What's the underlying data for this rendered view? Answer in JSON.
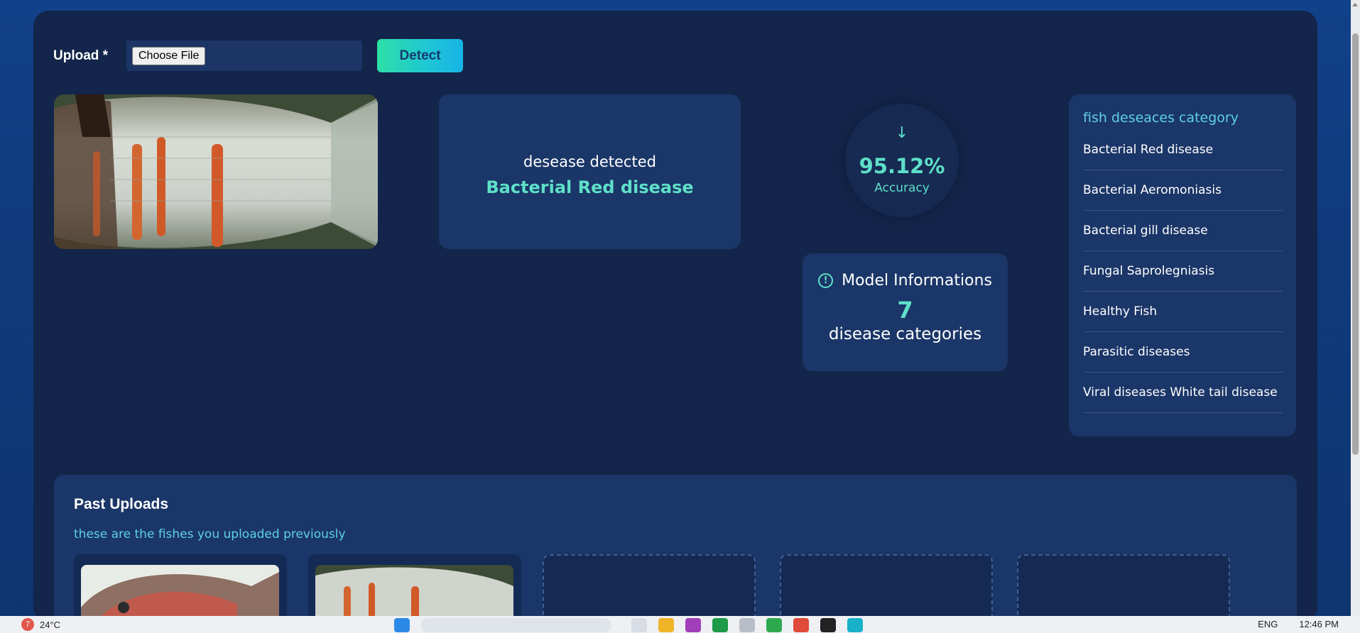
{
  "upload": {
    "label": "Upload *",
    "file_button": "Choose File",
    "detect_label": "Detect"
  },
  "result": {
    "label": "desease detected",
    "value": "Bacterial Red disease"
  },
  "accuracy": {
    "arrow": "↓",
    "value": "95.12%",
    "label": "Accuracy"
  },
  "model_info": {
    "title": "Model Informations",
    "count": "7",
    "subtitle": "disease categories"
  },
  "categories": {
    "title": "fish deseaces category",
    "items": [
      "Bacterial Red disease",
      "Bacterial Aeromoniasis",
      "Bacterial gill disease",
      "Fungal Saprolegniasis",
      "Healthy Fish",
      "Parasitic diseases",
      "Viral diseases White tail disease"
    ]
  },
  "past_uploads": {
    "title": "Past Uploads",
    "subtitle": "these are the fishes you uploaded previously"
  },
  "taskbar": {
    "weather_badge": "7",
    "temperature": "24°C",
    "language": "ENG",
    "time": "12:46 PM"
  },
  "colors": {
    "accent": "#5ee0c8",
    "panel": "#13254a",
    "card": "#1b3668",
    "detect_gradient_start": "#2ee0a6",
    "detect_gradient_end": "#18b4e6"
  }
}
